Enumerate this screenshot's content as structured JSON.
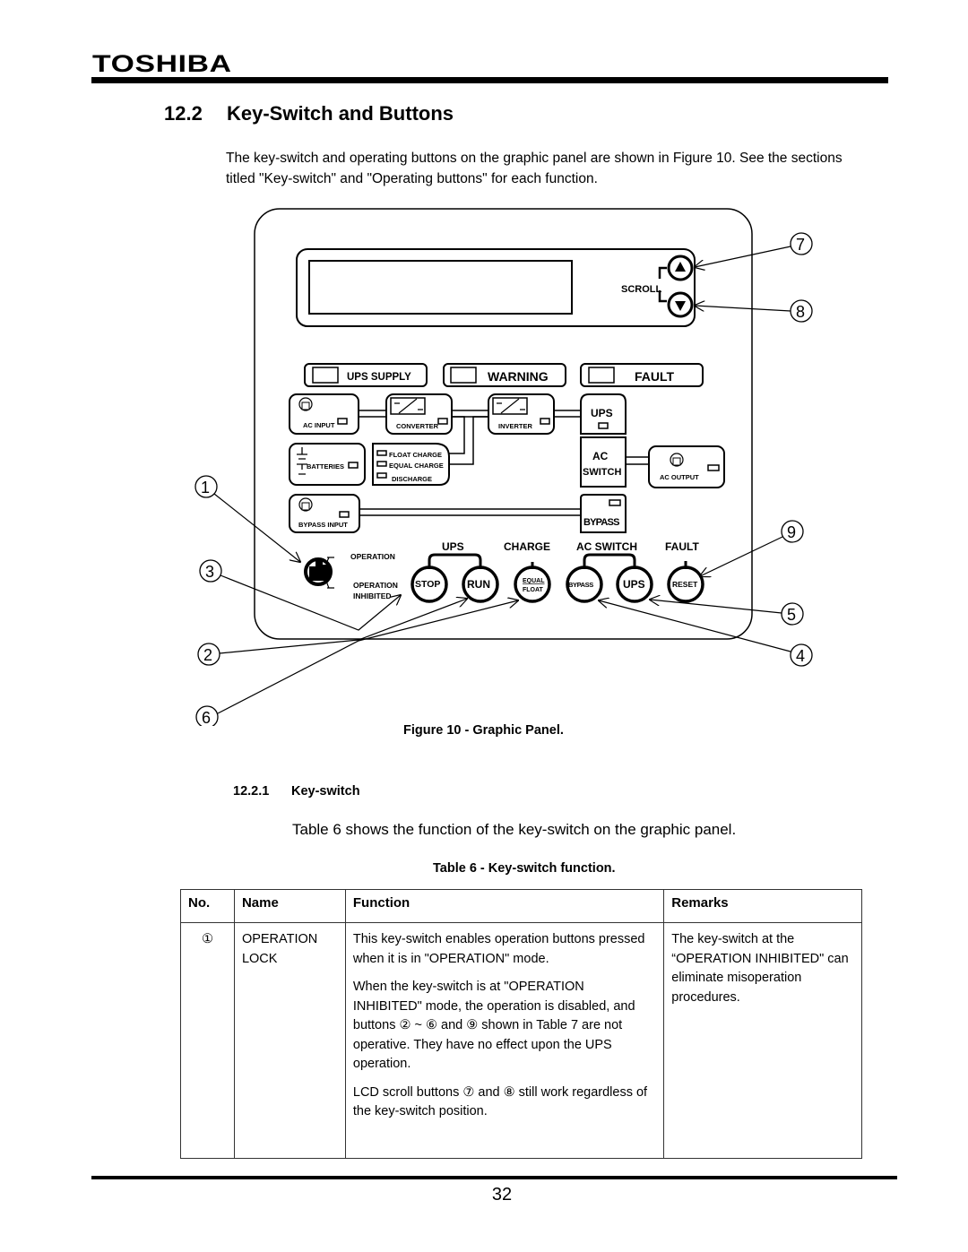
{
  "header": {
    "brand": "TOSHIBA"
  },
  "section": {
    "number": "12.2",
    "title": "Key-Switch and Buttons"
  },
  "intro": "The key-switch and operating buttons on the graphic panel are shown in Figure 10. See the sections titled \"Key-switch\" and \"Operating buttons\" for each function.",
  "figure": {
    "caption": "Figure 10 - Graphic Panel.",
    "scroll_label": "SCROLL",
    "status_lamps": [
      "UPS SUPPLY",
      "WARNING",
      "FAULT"
    ],
    "blocks": {
      "ac_input": "AC INPUT",
      "converter": "CONVERTER",
      "inverter": "INVERTER",
      "ups": "UPS",
      "batteries": "BATTERIES",
      "float_charge": "FLOAT CHARGE",
      "equal_charge": "EQUAL CHARGE",
      "discharge": "DISCHARGE",
      "ac_switch_line1": "AC",
      "ac_switch_line2": "SWITCH",
      "ac_output": "AC OUTPUT",
      "bypass_input": "BYPASS INPUT",
      "bypass": "BYPASS"
    },
    "keyswitch": {
      "operation": "OPERATION",
      "inhibited_line1": "OPERATION",
      "inhibited_line2": "INHIBITED"
    },
    "button_groups": {
      "ups": "UPS",
      "charge": "CHARGE",
      "ac_switch": "AC SWITCH",
      "fault": "FAULT"
    },
    "buttons": {
      "stop": "STOP",
      "run": "RUN",
      "equal": "EQUAL",
      "float": "FLOAT",
      "bypass": "BYPASS",
      "ups": "UPS",
      "reset": "RESET"
    },
    "callouts": {
      "c1": "1",
      "c2": "2",
      "c3": "3",
      "c4": "4",
      "c5": "5",
      "c6": "6",
      "c7": "7",
      "c8": "8",
      "c9": "9"
    }
  },
  "subsection": {
    "number": "12.2.1",
    "title": "Key-switch"
  },
  "table_intro": "Table 6 shows the function of the key-switch on the graphic panel.",
  "table": {
    "caption": "Table 6 - Key-switch function.",
    "headers": [
      "No.",
      "Name",
      "Function",
      "Remarks"
    ],
    "rows": [
      {
        "no": "①",
        "name_line1": "OPERATION",
        "name_line2": "LOCK",
        "function_p1": "This key-switch enables operation buttons pressed when it is in \"OPERATION\" mode.",
        "function_p2": "When the key-switch is at \"OPERATION INHIBITED\" mode, the operation is disabled, and buttons ② ~ ⑥ and ⑨ shown in Table 7 are not operative. They have no effect upon the UPS operation.",
        "function_p3": "LCD scroll buttons ⑦ and ⑧ still work regardless of the key-switch position.",
        "remarks": "The key-switch at the “OPERATION INHIBITED\" can eliminate misoperation procedures."
      }
    ]
  },
  "footer": {
    "page_number": "32"
  }
}
